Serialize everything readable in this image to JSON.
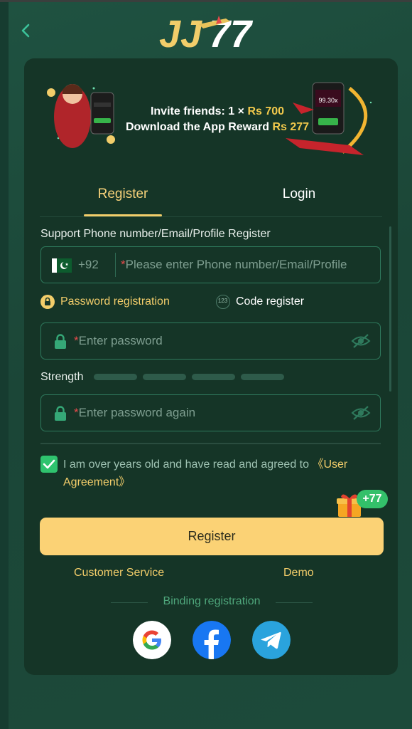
{
  "header": {
    "back_icon": "chevron-left-icon",
    "logo_text": "JJ77"
  },
  "banner": {
    "line1_prefix": "Invite friends: 1 × ",
    "line1_amount": "Rs 700",
    "line2_prefix": "Download the App Reward ",
    "line2_amount": "Rs 277"
  },
  "tabs": [
    {
      "label": "Register"
    },
    {
      "label": "Login"
    }
  ],
  "form": {
    "account_label": "Support Phone number/Email/Profile Register",
    "country_code": "+92",
    "account_placeholder": "Please enter Phone number/Email/Profile",
    "mode_password": "Password registration",
    "mode_code": "Code register",
    "mode_code_icon_text": "123",
    "password_placeholder": "Enter password",
    "strength_label": "Strength",
    "confirm_placeholder": "Enter password again",
    "required_mark": "*"
  },
  "agreement": {
    "text": "I am over years old and have read and agreed to ",
    "link": "《User Agreement》",
    "checked": true
  },
  "register_button": "Register",
  "reward_badge": "+77",
  "links": {
    "customer_service": "Customer Service",
    "demo": "Demo"
  },
  "binding": {
    "label": "Binding registration"
  },
  "social": [
    "google-icon",
    "facebook-icon",
    "telegram-icon"
  ],
  "colors": {
    "accent": "#f2cd6a",
    "card": "#153527",
    "button": "#fbd275",
    "check": "#2fc36e"
  }
}
